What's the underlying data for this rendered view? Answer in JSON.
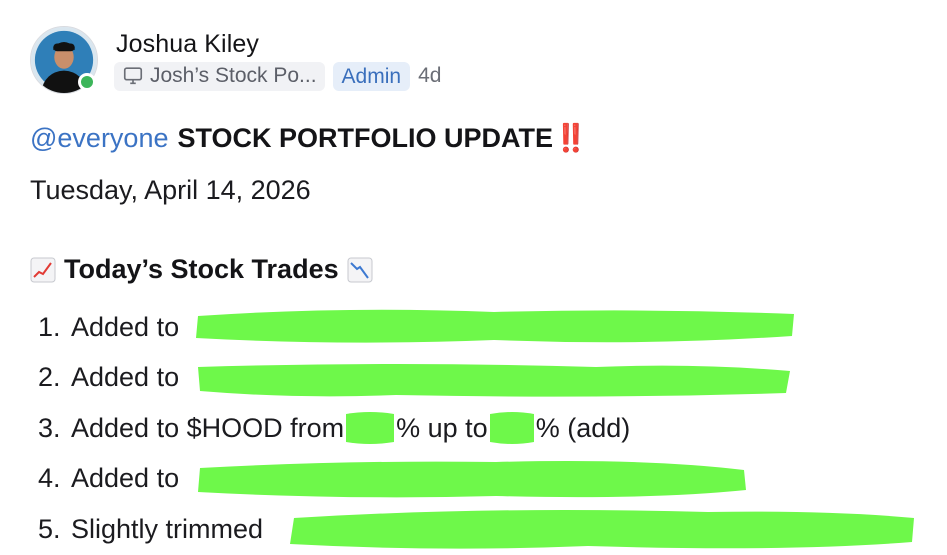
{
  "post": {
    "author": "Joshua Kiley",
    "channel": "Josh’s Stock Po...",
    "role_badge": "Admin",
    "age": "4d",
    "status": "online"
  },
  "message": {
    "mention": "@everyone",
    "title": "STOCK PORTFOLIO UPDATE",
    "title_emoji": "‼️",
    "date": "Tuesday, April 14, 2026",
    "section_title": "Today’s Stock Trades",
    "section_emoji_left": "chart-increasing-icon",
    "section_emoji_right": "chart-decreasing-icon",
    "trades": [
      {
        "num": "1.",
        "text": "Added to"
      },
      {
        "num": "2.",
        "text": "Added to"
      },
      {
        "num": "3.",
        "text": "Added to $HOOD from",
        "mid": "% up to",
        "end": "% (add)"
      },
      {
        "num": "4.",
        "text": "Added to"
      },
      {
        "num": "5.",
        "text": "Slightly trimmed"
      }
    ]
  },
  "colors": {
    "mention": "#3b73c4",
    "admin_badge_bg": "#e6eef9",
    "online": "#3cb55a",
    "redaction": "#6ef84a",
    "bangs": "#e0322e"
  }
}
